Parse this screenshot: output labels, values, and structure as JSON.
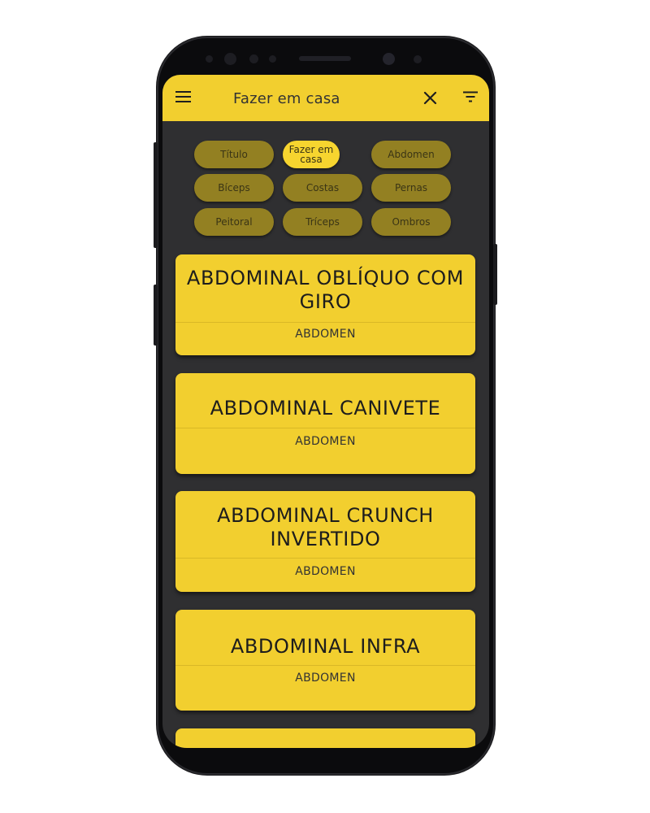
{
  "app_bar": {
    "title": "Fazer em casa",
    "menu_icon": "menu-icon",
    "close_icon": "close-icon",
    "filter_icon": "filter-icon",
    "background": "#f2cf2f"
  },
  "filters": {
    "chips": [
      {
        "label": "Título",
        "active": false
      },
      {
        "label": "Fazer em casa",
        "active": true
      },
      {
        "label": "Abdomen",
        "active": false
      },
      {
        "label": "Bíceps",
        "active": false
      },
      {
        "label": "Costas",
        "active": false
      },
      {
        "label": "Pernas",
        "active": false
      },
      {
        "label": "Peitoral",
        "active": false
      },
      {
        "label": "Tríceps",
        "active": false
      },
      {
        "label": "Ombros",
        "active": false
      }
    ],
    "active_color": "#f7d52f",
    "inactive_color": "#938022"
  },
  "exercises": [
    {
      "title": "ABDOMINAL OBLÍQUO COM GIRO",
      "category": "ABDOMEN"
    },
    {
      "title": "ABDOMINAL CANIVETE",
      "category": "ABDOMEN"
    },
    {
      "title": "ABDOMINAL CRUNCH INVERTIDO",
      "category": "ABDOMEN"
    },
    {
      "title": "ABDOMINAL INFRA",
      "category": "ABDOMEN"
    }
  ],
  "theme": {
    "screen_background": "#2f2f31",
    "card_color": "#f2cf2f"
  }
}
